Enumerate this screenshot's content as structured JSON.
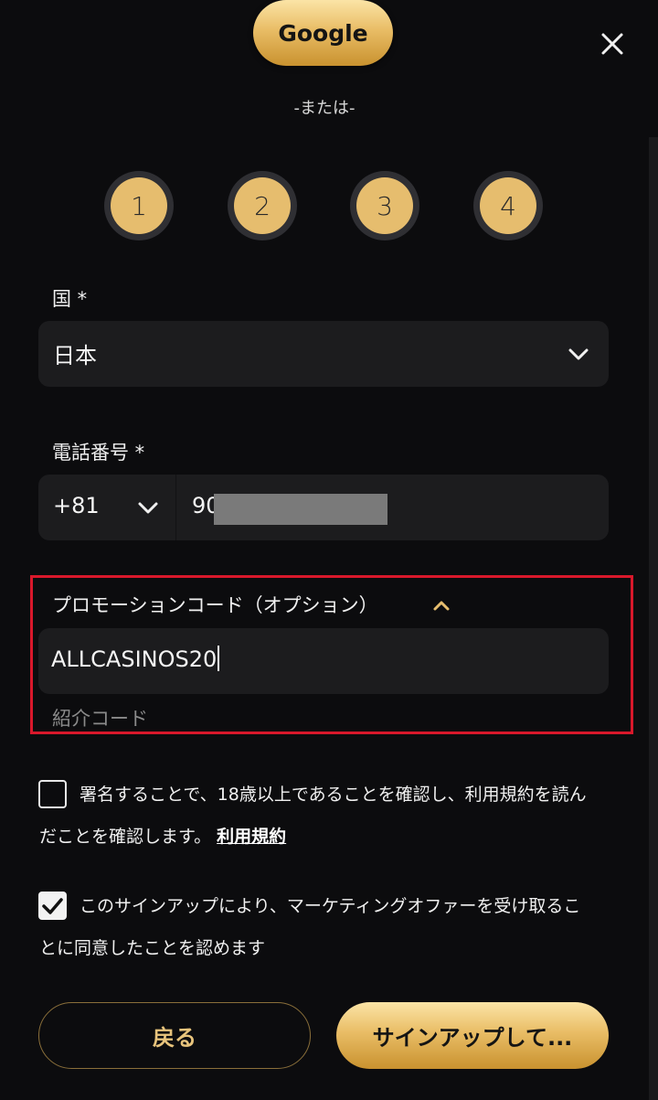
{
  "header": {
    "google_label": "Google",
    "or_text": "-または-"
  },
  "steps": [
    "1",
    "2",
    "3",
    "4"
  ],
  "country": {
    "label": "国 *",
    "value": "日本"
  },
  "phone": {
    "label": "電話番号 *",
    "code": "+81",
    "number_visible": "90"
  },
  "promo": {
    "label": "プロモーションコード（オプション）",
    "value": "ALLCASINOS20",
    "referral_label": "紹介コード"
  },
  "consent": {
    "line1": "署名することで、18歳以上であることを確認し、利用規約を読ん",
    "line2": "だことを確認します。",
    "terms_link": "利用規約",
    "checked": false
  },
  "marketing": {
    "line1": "このサインアップにより、マーケティングオファーを受け取るこ",
    "line2": "とに同意したことを認めます",
    "checked": true
  },
  "buttons": {
    "back": "戻る",
    "signup": "サインアップして..."
  },
  "colors": {
    "background": "#0c0c0e",
    "gold": "#e9bd66",
    "field": "#1c1c1e",
    "highlight_border": "#d9182b"
  }
}
